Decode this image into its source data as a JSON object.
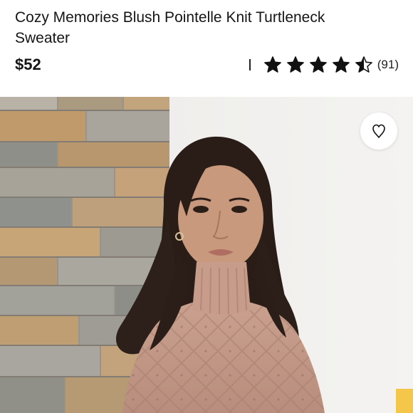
{
  "product": {
    "title": "Cozy Memories Blush Pointelle Knit Turtleneck Sweater",
    "price": "$52"
  },
  "rating": {
    "stars": 4.5,
    "max_stars": 5,
    "count_label": "(91)"
  },
  "icons": {
    "star": "star-icon",
    "half_star": "half-star-icon",
    "like": "heart-icon"
  },
  "colors": {
    "star": "#111111",
    "text": "#151515"
  }
}
